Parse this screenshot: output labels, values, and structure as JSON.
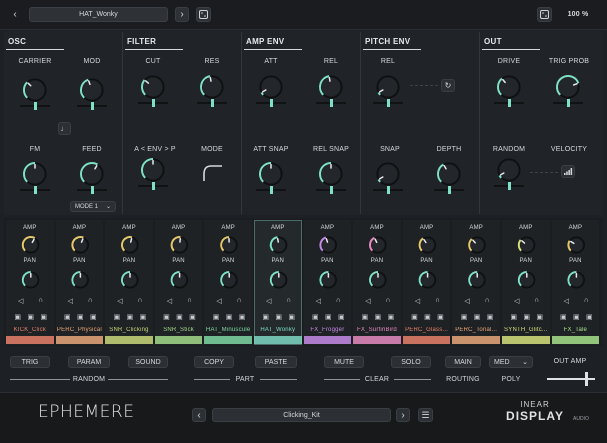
{
  "topbar": {
    "preset": "HAT_Wonky",
    "zoom": "100 %"
  },
  "sections": [
    {
      "title": "OSC"
    },
    {
      "title": "FILTER"
    },
    {
      "title": "AMP ENV"
    },
    {
      "title": "PITCH ENV"
    },
    {
      "title": "OUT"
    }
  ],
  "osc": {
    "carrier": "CARRIER",
    "mod": "MOD",
    "fm": "FM",
    "feed": "FEED",
    "mode": "MODE 1"
  },
  "filter": {
    "cut": "CUT",
    "res": "RES",
    "env": "A < ENV > P",
    "mode": "MODE"
  },
  "ampenv": {
    "att": "ATT",
    "rel": "REL",
    "att_snap": "ATT SNAP",
    "rel_snap": "REL SNAP"
  },
  "pitchenv": {
    "rel": "REL",
    "snap": "SNAP",
    "depth": "DEPTH"
  },
  "out": {
    "drive": "DRIVE",
    "trig_prob": "TRIG PROB",
    "random": "RANDOM",
    "velocity": "VELOCITY"
  },
  "mixer": {
    "amp_label": "AMP",
    "pan_label": "PAN",
    "channels": [
      {
        "name": "KICK_Click",
        "color": "#e8806a"
      },
      {
        "name": "PERC_Physical",
        "color": "#e8a77a"
      },
      {
        "name": "SNR_Clicking",
        "color": "#c9d77a"
      },
      {
        "name": "SNR_Stick",
        "color": "#a3d98a"
      },
      {
        "name": "HAT_Minuscule",
        "color": "#7fd7a3"
      },
      {
        "name": "HAT_Wonky",
        "color": "#7fd7c4"
      },
      {
        "name": "FX_Frogger",
        "color": "#c58be6"
      },
      {
        "name": "FX_SurfinBird",
        "color": "#e68ac0"
      },
      {
        "name": "PERC_Glass...",
        "color": "#e8806a"
      },
      {
        "name": "PERC_Tonal...",
        "color": "#e8a77a"
      },
      {
        "name": "SYNTH_Glitc...",
        "color": "#d6df7a"
      },
      {
        "name": "FX_Tale",
        "color": "#a8e08b"
      }
    ]
  },
  "bottom": {
    "trig": "TRIG",
    "param": "PARAM",
    "sound": "SOUND",
    "copy": "COPY",
    "paste": "PASTE",
    "mute": "MUTE",
    "solo": "SOLO",
    "main": "MAIN",
    "med": "MED",
    "random": "RANDOM",
    "part": "PART",
    "clear": "CLEAR",
    "routing": "ROUTING",
    "poly": "POLY",
    "out_amp": "OUT AMP"
  },
  "footer": {
    "logo": "EPHEMERE",
    "kit": "Clicking_Kit",
    "brand1": "INEAR",
    "brand2": "DISPLAY",
    "brand3": "AUDIO"
  }
}
